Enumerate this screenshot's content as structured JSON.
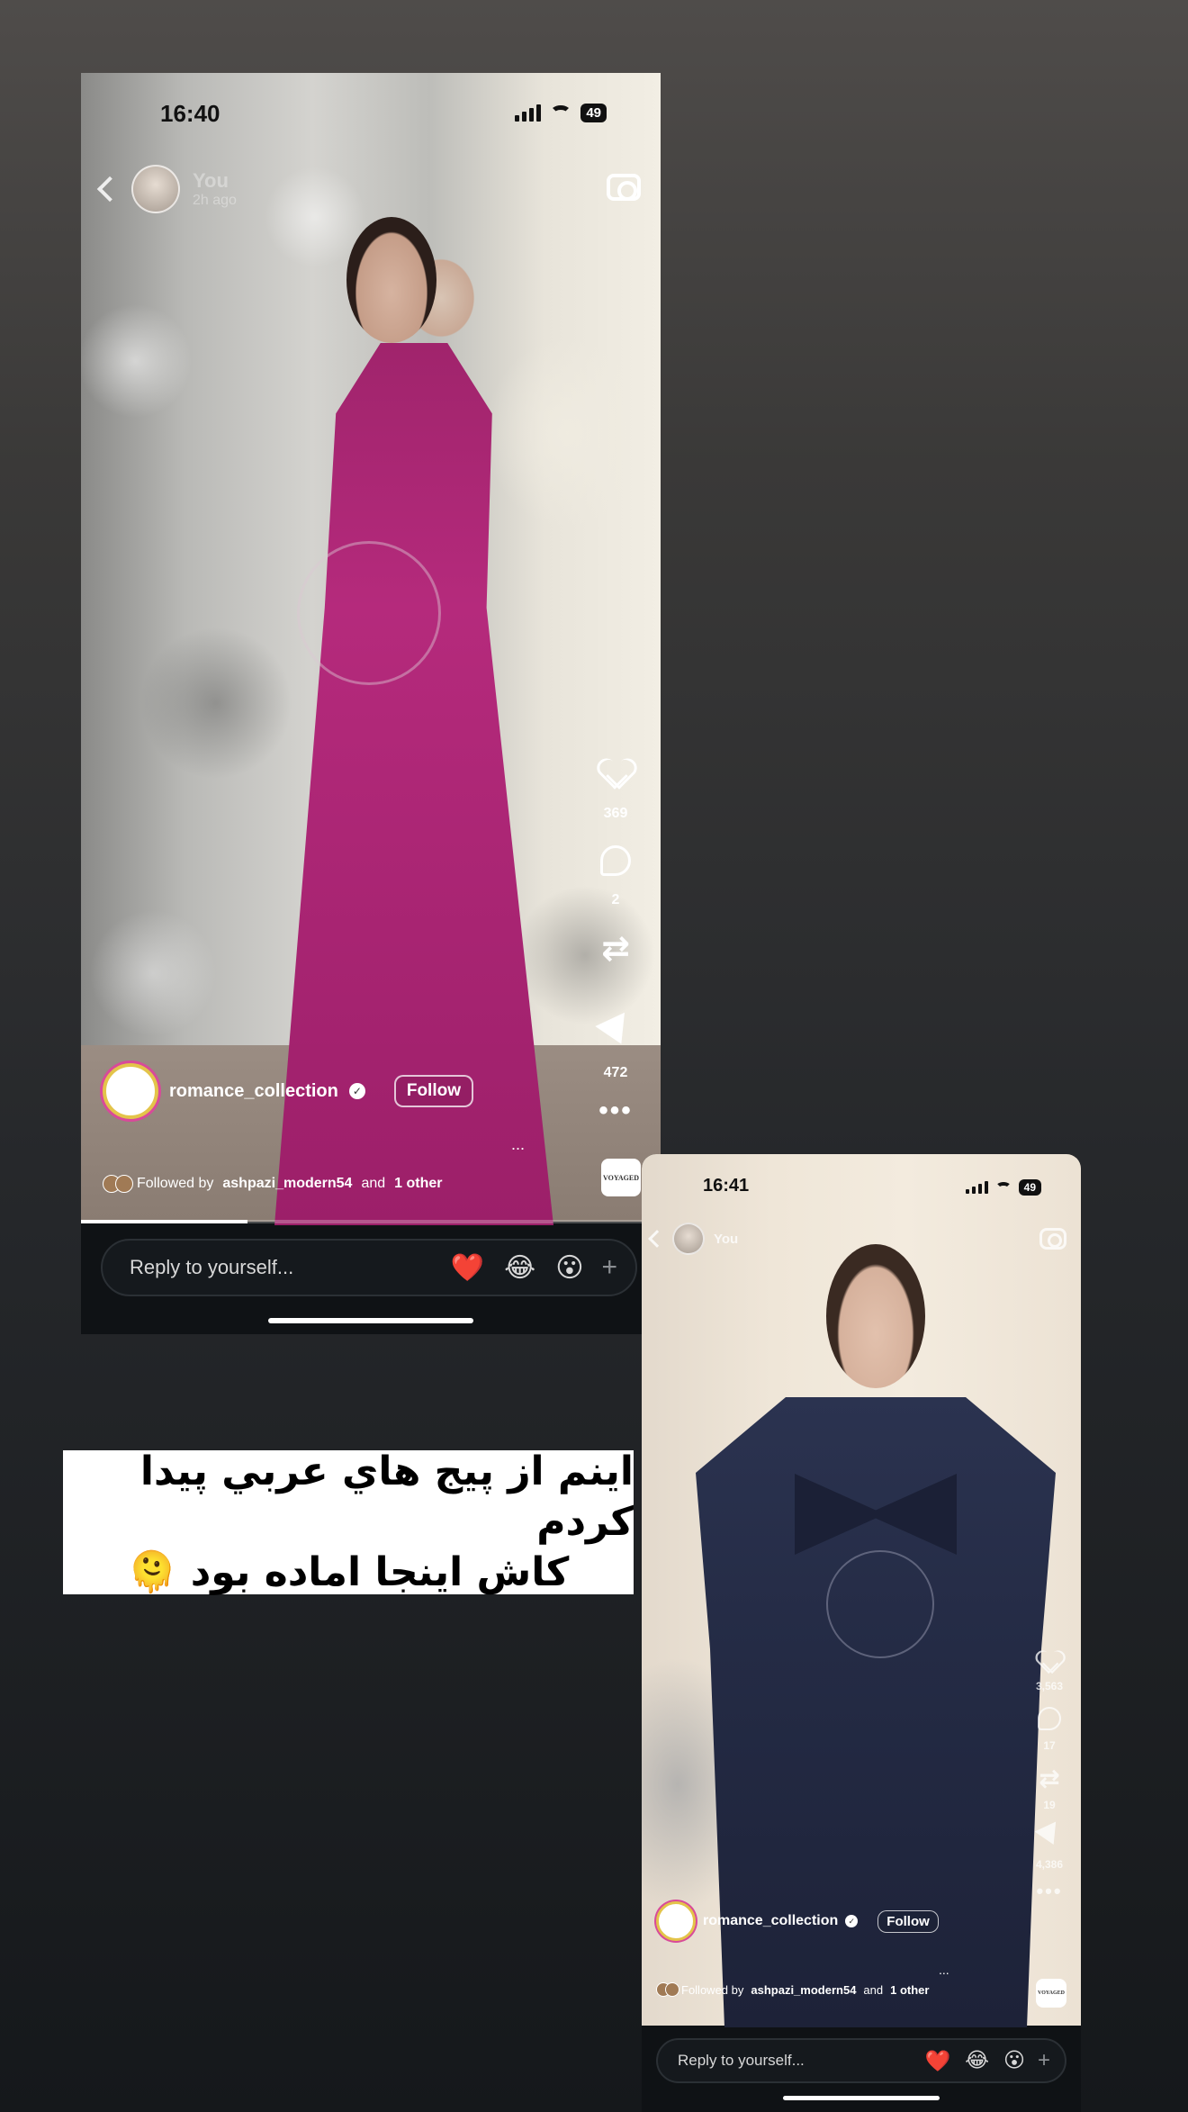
{
  "story_one": {
    "status": {
      "time": "16:40",
      "battery": "49"
    },
    "header": {
      "user": "You",
      "ago": "2h ago"
    },
    "actions": {
      "likes": "369",
      "comments": "2",
      "reposts": "",
      "shares": "472"
    },
    "creator": {
      "username": "romance_collection",
      "follow_label": "Follow"
    },
    "followed_by": {
      "prefix": "Followed by",
      "user": "ashpazi_modern54",
      "connector": "and",
      "others": "1 other"
    },
    "sound_badge": "VOYAGED",
    "caption_ellipsis": "...",
    "reply": {
      "placeholder": "Reply to yourself...",
      "emojis": [
        "❤️",
        "😂",
        "😮"
      ],
      "plus": "+"
    }
  },
  "caption": {
    "line1": "اینم از پیج هاي عربي پیدا کردم",
    "line2": "کاش اینجا اماده بود 🫠"
  },
  "story_two": {
    "status": {
      "time": "16:41",
      "battery": "49"
    },
    "header": {
      "user": "You",
      "ago": ""
    },
    "actions": {
      "likes": "3,563",
      "comments": "17",
      "reposts": "19",
      "shares": "4,386"
    },
    "creator": {
      "username": "romance_collection",
      "follow_label": "Follow"
    },
    "followed_by": {
      "prefix": "Followed by",
      "user": "ashpazi_modern54",
      "connector": "and",
      "others": "1 other"
    },
    "sound_badge": "VOYAGED",
    "caption_ellipsis": "...",
    "reply": {
      "placeholder": "Reply to yourself...",
      "emojis": [
        "❤️",
        "😂",
        "😮"
      ],
      "plus": "+"
    }
  },
  "colors": {
    "background_top": "#4f4c4a",
    "background_bottom": "#15181b",
    "dress_one": "#a0246c",
    "dress_two": "#242b45",
    "creator_ring": "#d84a9a"
  }
}
